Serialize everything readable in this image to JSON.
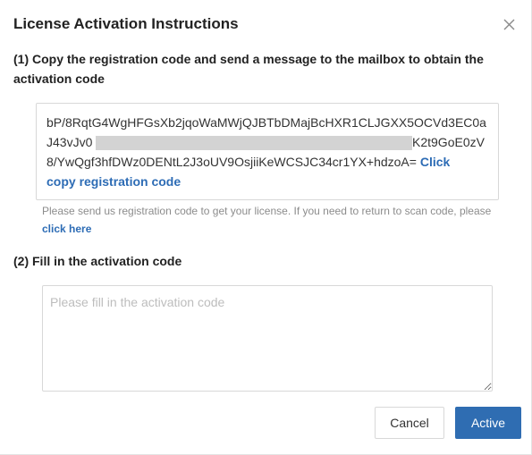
{
  "dialog": {
    "title": "License Activation Instructions",
    "close_icon": "close-icon"
  },
  "step1": {
    "heading": "(1) Copy the registration code and send a message to the mailbox to obtain the activation code",
    "code_line1": "bP/8RqtG4WgHFGsXb2jqoWaMWjQJBTbDMajBcHXR1CLJGXX5OCVd3EC0a",
    "code_line2_start": "J43vJv0",
    "code_line2_end": "K2t9GoE0zV",
    "code_line3": "8/YwQgf3hfDWz0DENtL2J3oUV9OsjiiKeWCSJC34cr1YX+hdzoA=",
    "copy_link_part1": "Click",
    "copy_link_part2": "copy registration code",
    "hint_text": "Please send us registration code to get your license. If you need to return to scan code, please",
    "hint_link": "click here"
  },
  "step2": {
    "heading": "(2) Fill in the activation code",
    "input_value": "",
    "input_placeholder": "Please fill in the activation code"
  },
  "buttons": {
    "cancel": "Cancel",
    "active": "Active"
  },
  "colors": {
    "link": "#2d6cb5",
    "primary_button": "#2f6db2",
    "redaction": "#d3d3d3"
  }
}
